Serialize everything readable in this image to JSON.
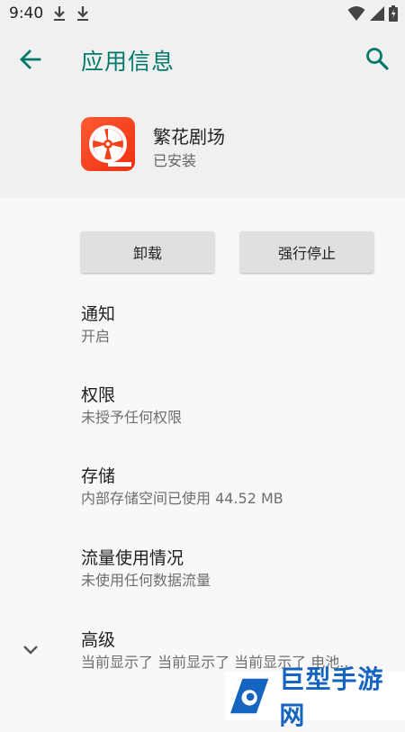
{
  "status_bar": {
    "time": "9:40",
    "icons": [
      "download-icon",
      "download-icon",
      "wifi-icon",
      "signal-icon",
      "battery-icon"
    ]
  },
  "app_bar": {
    "title": "应用信息",
    "back_icon": "arrow-back-icon",
    "search_icon": "search-icon",
    "accent_color": "#00796b"
  },
  "app": {
    "name": "繁花剧场",
    "status": "已安装",
    "icon": "film-reel-icon",
    "icon_color": "#f4411c"
  },
  "buttons": {
    "uninstall": "卸载",
    "force_stop": "强行停止"
  },
  "settings": [
    {
      "title": "通知",
      "subtitle": "开启"
    },
    {
      "title": "权限",
      "subtitle": "未授予任何权限"
    },
    {
      "title": "存储",
      "subtitle": "内部存储空间已使用 44.52 MB"
    },
    {
      "title": "流量使用情况",
      "subtitle": "未使用任何数据流量"
    },
    {
      "title": "高级",
      "subtitle": "当前显示了 当前显示了 当前显示了 电池.."
    }
  ],
  "advanced_icon": "chevron-down-icon",
  "watermark": {
    "text": "巨型手游网",
    "color": "#1565c0"
  }
}
